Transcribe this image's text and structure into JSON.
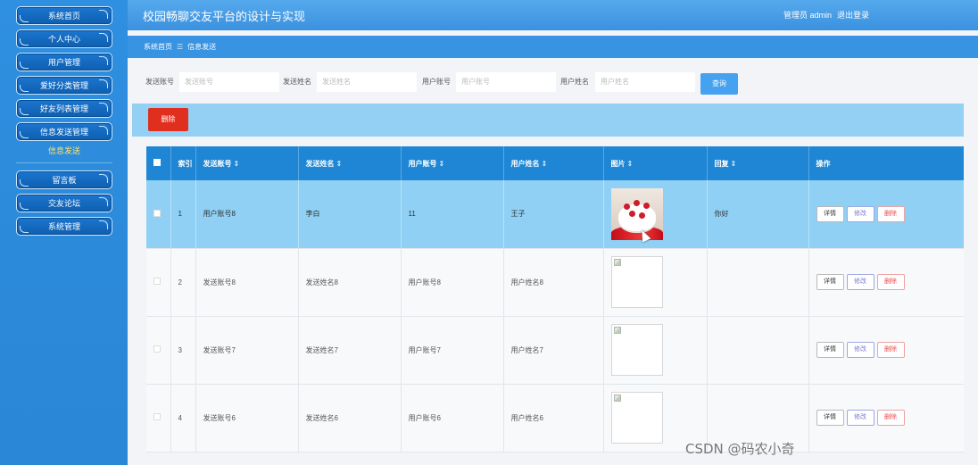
{
  "app": {
    "title": "校园畅聊交友平台的设计与实现",
    "admin_label": "管理员 admin",
    "logout_label": "退出登录"
  },
  "sidebar": {
    "items": [
      {
        "label": "系统首页"
      },
      {
        "label": "个人中心"
      },
      {
        "label": "用户管理"
      },
      {
        "label": "爱好分类管理"
      },
      {
        "label": "好友列表管理"
      },
      {
        "label": "信息发送管理"
      },
      {
        "label": "留言板"
      },
      {
        "label": "交友论坛"
      },
      {
        "label": "系统管理"
      }
    ],
    "active_submenu": "信息发送"
  },
  "breadcrumb": {
    "home": "系统首页",
    "separator": "☰",
    "current": "信息发送"
  },
  "search": {
    "fields": [
      {
        "label": "发送账号",
        "placeholder": "发送账号"
      },
      {
        "label": "发送姓名",
        "placeholder": "发送姓名"
      },
      {
        "label": "用户账号",
        "placeholder": "用户账号"
      },
      {
        "label": "用户姓名",
        "placeholder": "用户姓名"
      }
    ],
    "query_label": "查询"
  },
  "toolbar": {
    "delete_label": "删除"
  },
  "table": {
    "headers": [
      "索引",
      "发送账号",
      "发送姓名",
      "用户账号",
      "用户姓名",
      "图片",
      "回复",
      "操作"
    ],
    "sort_icon": "⇕",
    "rows": [
      {
        "index": "1",
        "sender_account": "用户账号8",
        "sender_name": "李白",
        "user_account": "11",
        "user_name": "王子",
        "reply": "你好",
        "image": "cake"
      },
      {
        "index": "2",
        "sender_account": "发送账号8",
        "sender_name": "发送姓名8",
        "user_account": "用户账号8",
        "user_name": "用户姓名8",
        "reply": "",
        "image": "broken"
      },
      {
        "index": "3",
        "sender_account": "发送账号7",
        "sender_name": "发送姓名7",
        "user_account": "用户账号7",
        "user_name": "用户姓名7",
        "reply": "",
        "image": "broken"
      },
      {
        "index": "4",
        "sender_account": "发送账号6",
        "sender_name": "发送姓名6",
        "user_account": "用户账号6",
        "user_name": "用户姓名6",
        "reply": "",
        "image": "broken"
      }
    ],
    "actions": {
      "detail": "详情",
      "edit": "修改",
      "delete": "删除"
    }
  },
  "watermark": "CSDN @码农小奇"
}
